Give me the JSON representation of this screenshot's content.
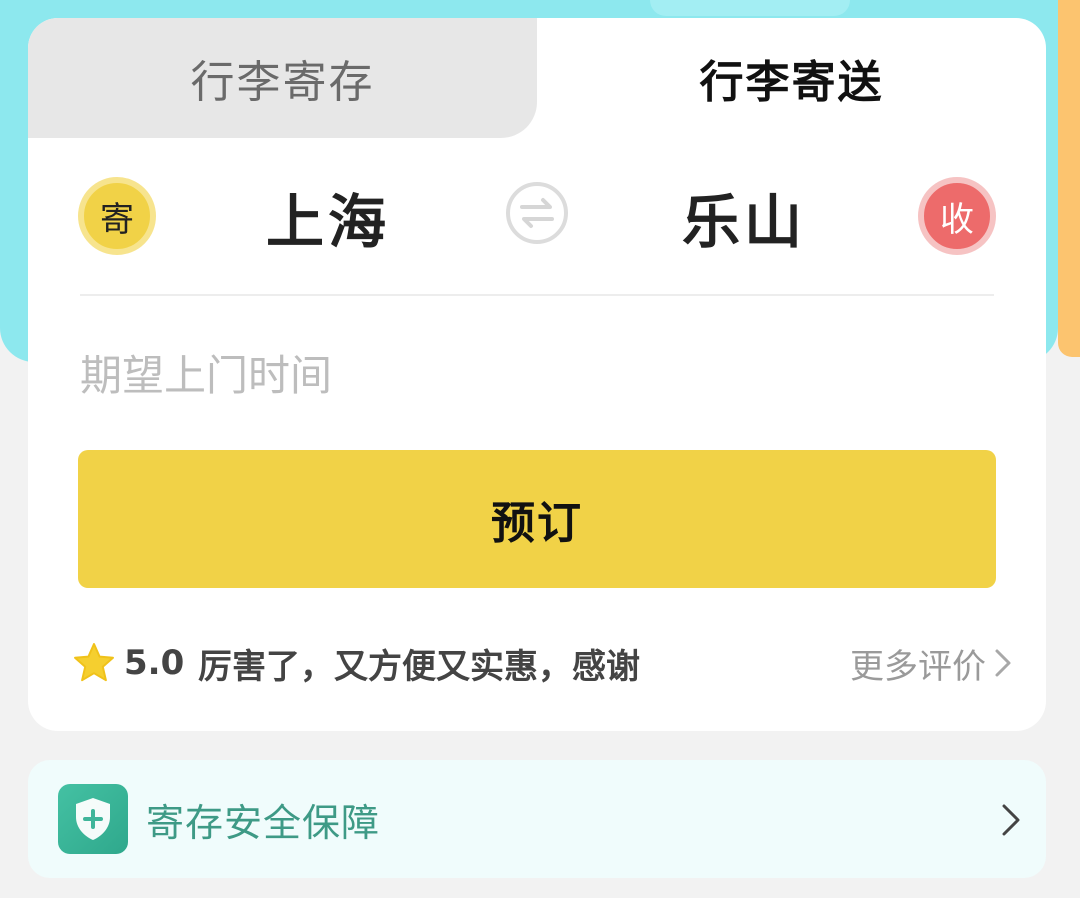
{
  "tabs": [
    {
      "label": "行李寄存",
      "active": false
    },
    {
      "label": "行李寄送",
      "active": true
    }
  ],
  "route": {
    "send_badge": "寄",
    "from_city": "上海",
    "to_city": "乐山",
    "receive_badge": "收"
  },
  "time_field": {
    "placeholder": "期望上门时间"
  },
  "book_button": {
    "label": "预订"
  },
  "review": {
    "rating": "5.0",
    "text": "厉害了，又方便又实惠，感谢",
    "more_label": "更多评价"
  },
  "safety": {
    "label": "寄存安全保障"
  },
  "colors": {
    "accent_yellow": "#f1d247",
    "receive_red": "#ed6b6b",
    "header_cyan": "#8de8ee",
    "safety_green": "#3e9a86"
  },
  "icons": {
    "swap": "swap-arrows-icon",
    "star": "star-icon",
    "shield": "shield-plus-icon",
    "chevron": "chevron-right-icon"
  }
}
